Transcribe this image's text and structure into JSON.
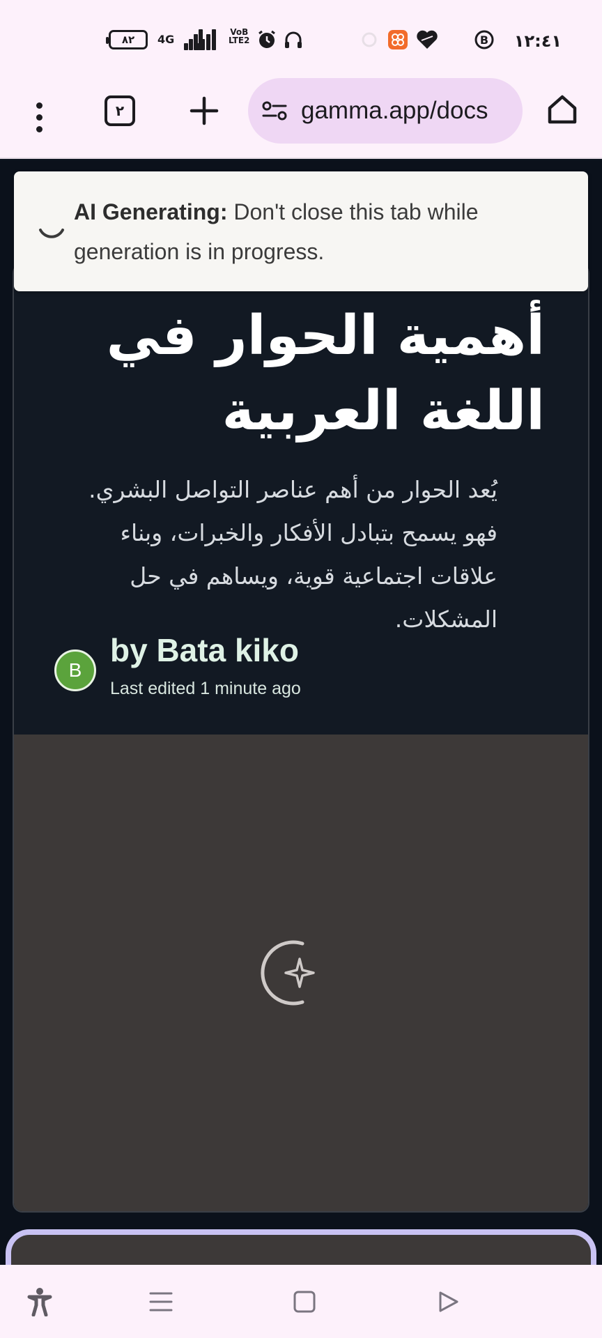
{
  "status_bar": {
    "time": "١٢:٤١",
    "battery": "٨٢",
    "network": "4G",
    "volte": [
      "VoB",
      "LTE2"
    ],
    "icons": [
      "battery-icon",
      "signal-icon",
      "alarm-icon",
      "headphones-icon",
      "app-notification-icon",
      "heart-icon",
      "b-circle-icon"
    ]
  },
  "browser": {
    "tab_count": "٢",
    "url": "gamma.app/docs",
    "icons": [
      "menu-kebab-icon",
      "tab-switcher-icon",
      "plus-icon",
      "site-settings-icon",
      "home-icon"
    ]
  },
  "toast": {
    "bold_label": "AI Generating:",
    "message": " Don't close this tab while generation is in progress."
  },
  "doc": {
    "title": "أهمية الحوار في اللغة العربية",
    "subtitle": "يُعد الحوار من أهم عناصر التواصل البشري. فهو يسمح بتبادل الأفكار والخبرات، وبناء علاقات اجتماعية قوية، ويساهم في حل المشكلات.",
    "author_initial": "B",
    "author": "by Bata kiko",
    "edited": "Last edited 1 minute ago"
  },
  "colors": {
    "card_dark": "#121923",
    "media_bg": "#3d3938",
    "avatar": "#5ba33c",
    "omnibox": "#efd7f4",
    "next_card_border": "#c9c2f3"
  },
  "nav_bar": {
    "icons": [
      "accessibility-icon",
      "recents-icon",
      "home-square-icon",
      "back-icon"
    ]
  }
}
